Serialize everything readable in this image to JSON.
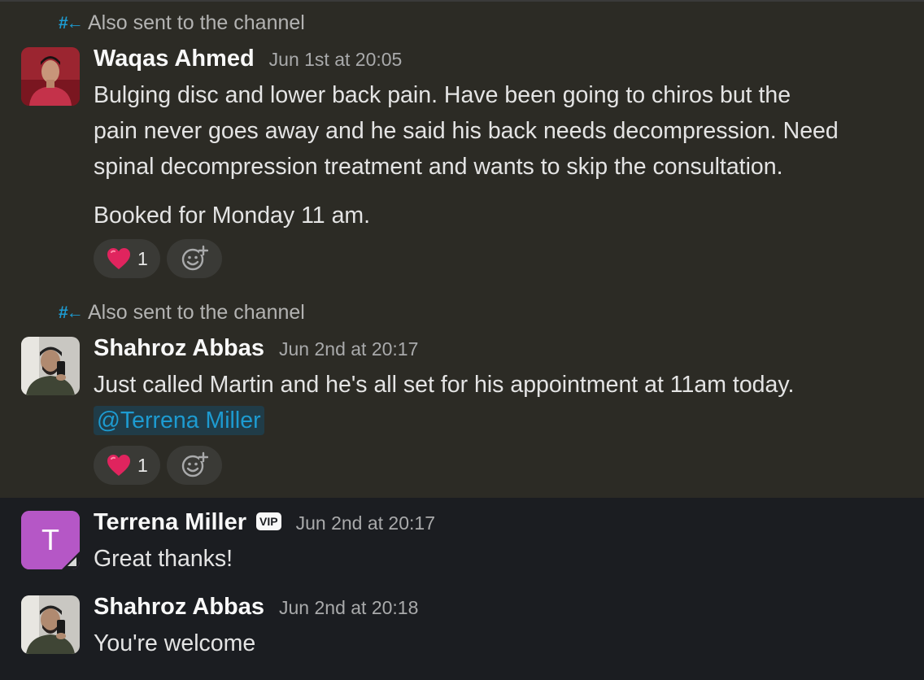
{
  "thread": [
    {
      "also_sent": "Also sent to the channel",
      "author": "Waqas Ahmed",
      "timestamp": "Jun 1st at 20:05",
      "text_lines": [
        "Bulging disc and lower back pain. Have been going to chiros but the",
        "pain never goes away and he said his back needs decompression. Need",
        "spinal decompression treatment and wants to skip the consultation."
      ],
      "text_extra": "Booked for Monday 11 am.",
      "reaction": {
        "emoji": "heart-emoji",
        "count": "1"
      }
    },
    {
      "also_sent": "Also sent to the channel",
      "author": "Shahroz Abbas",
      "timestamp": "Jun 2nd at 20:17",
      "text": "Just called Martin and he's all set for his appointment at 11am today.",
      "mention": "@Terrena Miller",
      "reaction": {
        "emoji": "heart-emoji",
        "count": "1"
      }
    },
    {
      "author": "Terrena Miller",
      "avatar_letter": "T",
      "badge": "VIP",
      "timestamp": "Jun 2nd at 20:17",
      "text": "Great thanks!"
    },
    {
      "author": "Shahroz Abbas",
      "timestamp": "Jun 2nd at 20:18",
      "text": "You're welcome"
    }
  ],
  "colors": {
    "highlight_bg": "#2c2b25",
    "base_bg": "#1b1d21",
    "link": "#1d9bd1",
    "avatar_t": "#b557c6"
  }
}
